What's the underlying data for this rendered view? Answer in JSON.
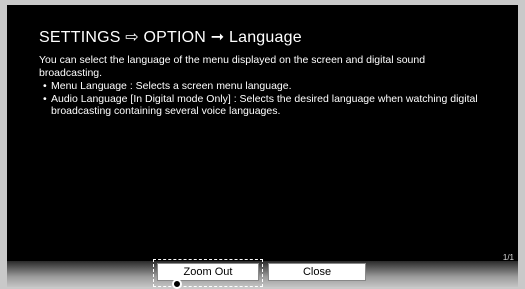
{
  "breadcrumb": {
    "part1": "SETTINGS",
    "sep1": "⇨",
    "part2": "OPTION",
    "sep2": "➞",
    "part3": "Language"
  },
  "description": "You can select the language of the menu displayed on the screen and digital sound broadcasting.",
  "bullets": [
    {
      "dot": "•",
      "text": "Menu Language : Selects a screen menu language."
    },
    {
      "dot": "•",
      "text": "Audio Language [In Digital mode Only] : Selects the desired language when watching digital broadcasting containing several voice languages."
    }
  ],
  "page_indicator": "1/1",
  "buttons": {
    "zoom_out": "Zoom Out",
    "close": "Close"
  }
}
